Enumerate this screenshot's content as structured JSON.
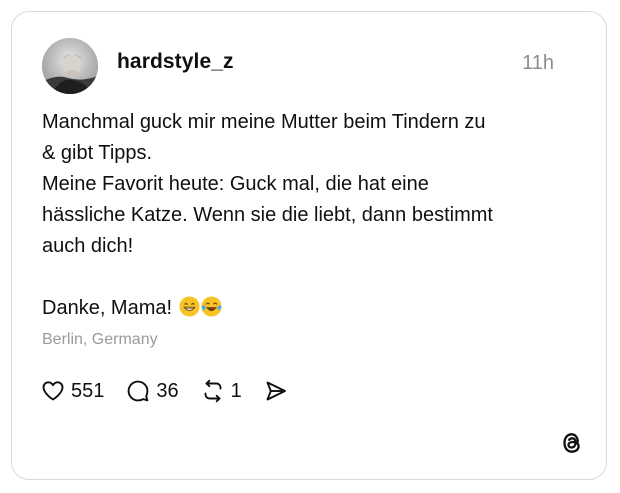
{
  "post": {
    "username": "hardstyle_z",
    "timestamp": "11h",
    "text_lines": {
      "l1": "Manchmal guck mir meine Mutter beim Tindern zu",
      "l2": "& gibt Tipps.",
      "l3": "Meine Favorit heute: Guck mal, die hat eine",
      "l4": "hässliche Katze. Wenn sie die liebt, dann bestimmt",
      "l5": "auch dich!",
      "l6": "Danke, Mama!"
    },
    "emojis": [
      "grinning-face-icon",
      "face-with-tears-of-joy-icon"
    ],
    "location": "Berlin, Germany"
  },
  "actions": {
    "likes": "551",
    "replies": "36",
    "reposts": "1"
  },
  "icons": {
    "like": "heart-icon",
    "reply": "comment-bubble-icon",
    "repost": "repost-arrows-icon",
    "share": "send-icon",
    "brand": "threads-logo-icon"
  },
  "colors": {
    "text": "#101010",
    "muted": "#8e8e8e",
    "border": "#d9d9d9",
    "emoji_yellow": "#f7c325"
  }
}
